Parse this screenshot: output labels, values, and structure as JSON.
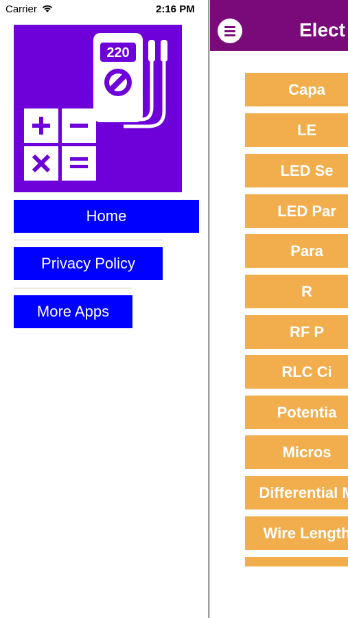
{
  "status_bar": {
    "carrier": "Carrier",
    "time": "2:16 PM"
  },
  "drawer": {
    "logo": {
      "display_value": "220"
    },
    "menu": [
      {
        "label": "Home"
      },
      {
        "label": "Privacy Policy"
      },
      {
        "label": "More Apps"
      }
    ],
    "button_color": "#0000ff"
  },
  "main": {
    "title": "Elect",
    "header_color": "#7a0a7a",
    "item_color": "#f2ae4c",
    "items": [
      {
        "label": "Capa"
      },
      {
        "label": "LE"
      },
      {
        "label": "LED Se"
      },
      {
        "label": "LED Par"
      },
      {
        "label": "Para"
      },
      {
        "label": "R"
      },
      {
        "label": "RF P"
      },
      {
        "label": "RLC Ci"
      },
      {
        "label": "Potentia"
      },
      {
        "label": "Micros"
      },
      {
        "label": "Differential M"
      },
      {
        "label": "Wire Length"
      },
      {
        "label": ""
      }
    ]
  }
}
